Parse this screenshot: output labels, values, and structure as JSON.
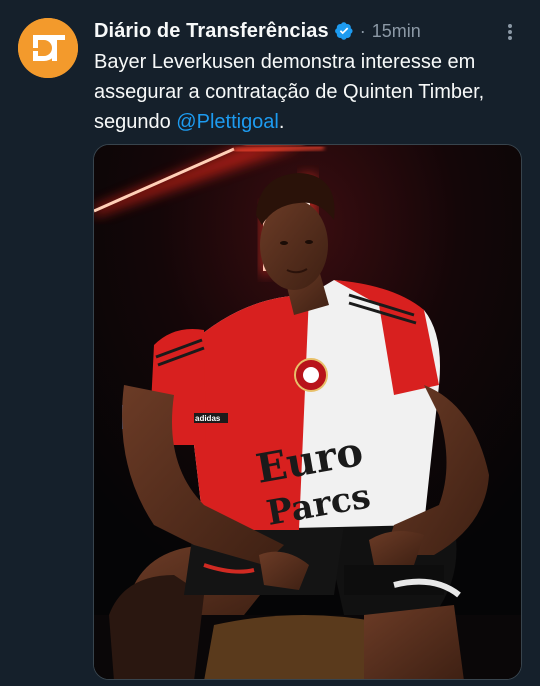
{
  "tweet": {
    "author": {
      "display_name": "Diário de Transferências",
      "avatar_initials": "DT",
      "verified": true
    },
    "separator": "·",
    "time": "15min",
    "text_before_mention": "Bayer Leverkusen demonstra interesse em assegurar a contratação de Quinten Timber, segundo ",
    "mention": "@Plettigoal",
    "text_after_mention": ".",
    "media": {
      "shirt_sponsor_line1": "Euro",
      "shirt_sponsor_line2": "Parcs",
      "kit_brand": "adidas"
    }
  },
  "colors": {
    "background": "#15202b",
    "text": "#f7f9f9",
    "secondary": "#8b98a5",
    "accent": "#1d9bf0",
    "avatar": "#f39a2c",
    "neon": "#ff3b2f"
  },
  "icons": {
    "verified": "verified-badge-icon",
    "more": "more-options-icon"
  }
}
